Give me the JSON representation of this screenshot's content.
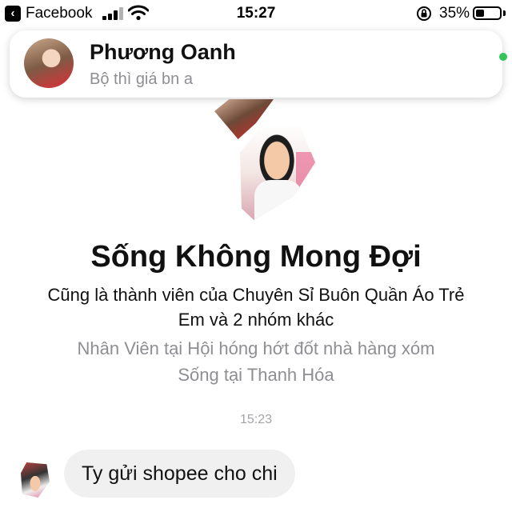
{
  "status_bar": {
    "back_app": "Facebook",
    "time": "15:27",
    "battery_percent": "35%",
    "battery_level": 0.35,
    "icons": [
      "back-icon",
      "cellular-signal-icon",
      "wifi-icon",
      "orientation-lock-icon",
      "battery-icon"
    ]
  },
  "notification": {
    "sender": "Phương Oanh",
    "message": "Bộ thì giá bn a"
  },
  "group": {
    "title": "Sống Không Mong Đợi",
    "description": "Cũng là thành viên của Chuyên Sỉ Buôn Quần Áo Trẻ Em và 2 nhóm khác",
    "work": "Nhân Viên tại Hội hóng hớt đốt nhà hàng xóm",
    "lives": "Sống tại Thanh Hóa"
  },
  "conversation": {
    "timestamp": "15:23",
    "messages": [
      {
        "text": "Ty gửi shopee cho chi",
        "incoming": true
      }
    ]
  },
  "colors": {
    "bubble_bg": "#f0f0f0",
    "online": "#31c45b",
    "secondary_text": "#8e8e93"
  }
}
